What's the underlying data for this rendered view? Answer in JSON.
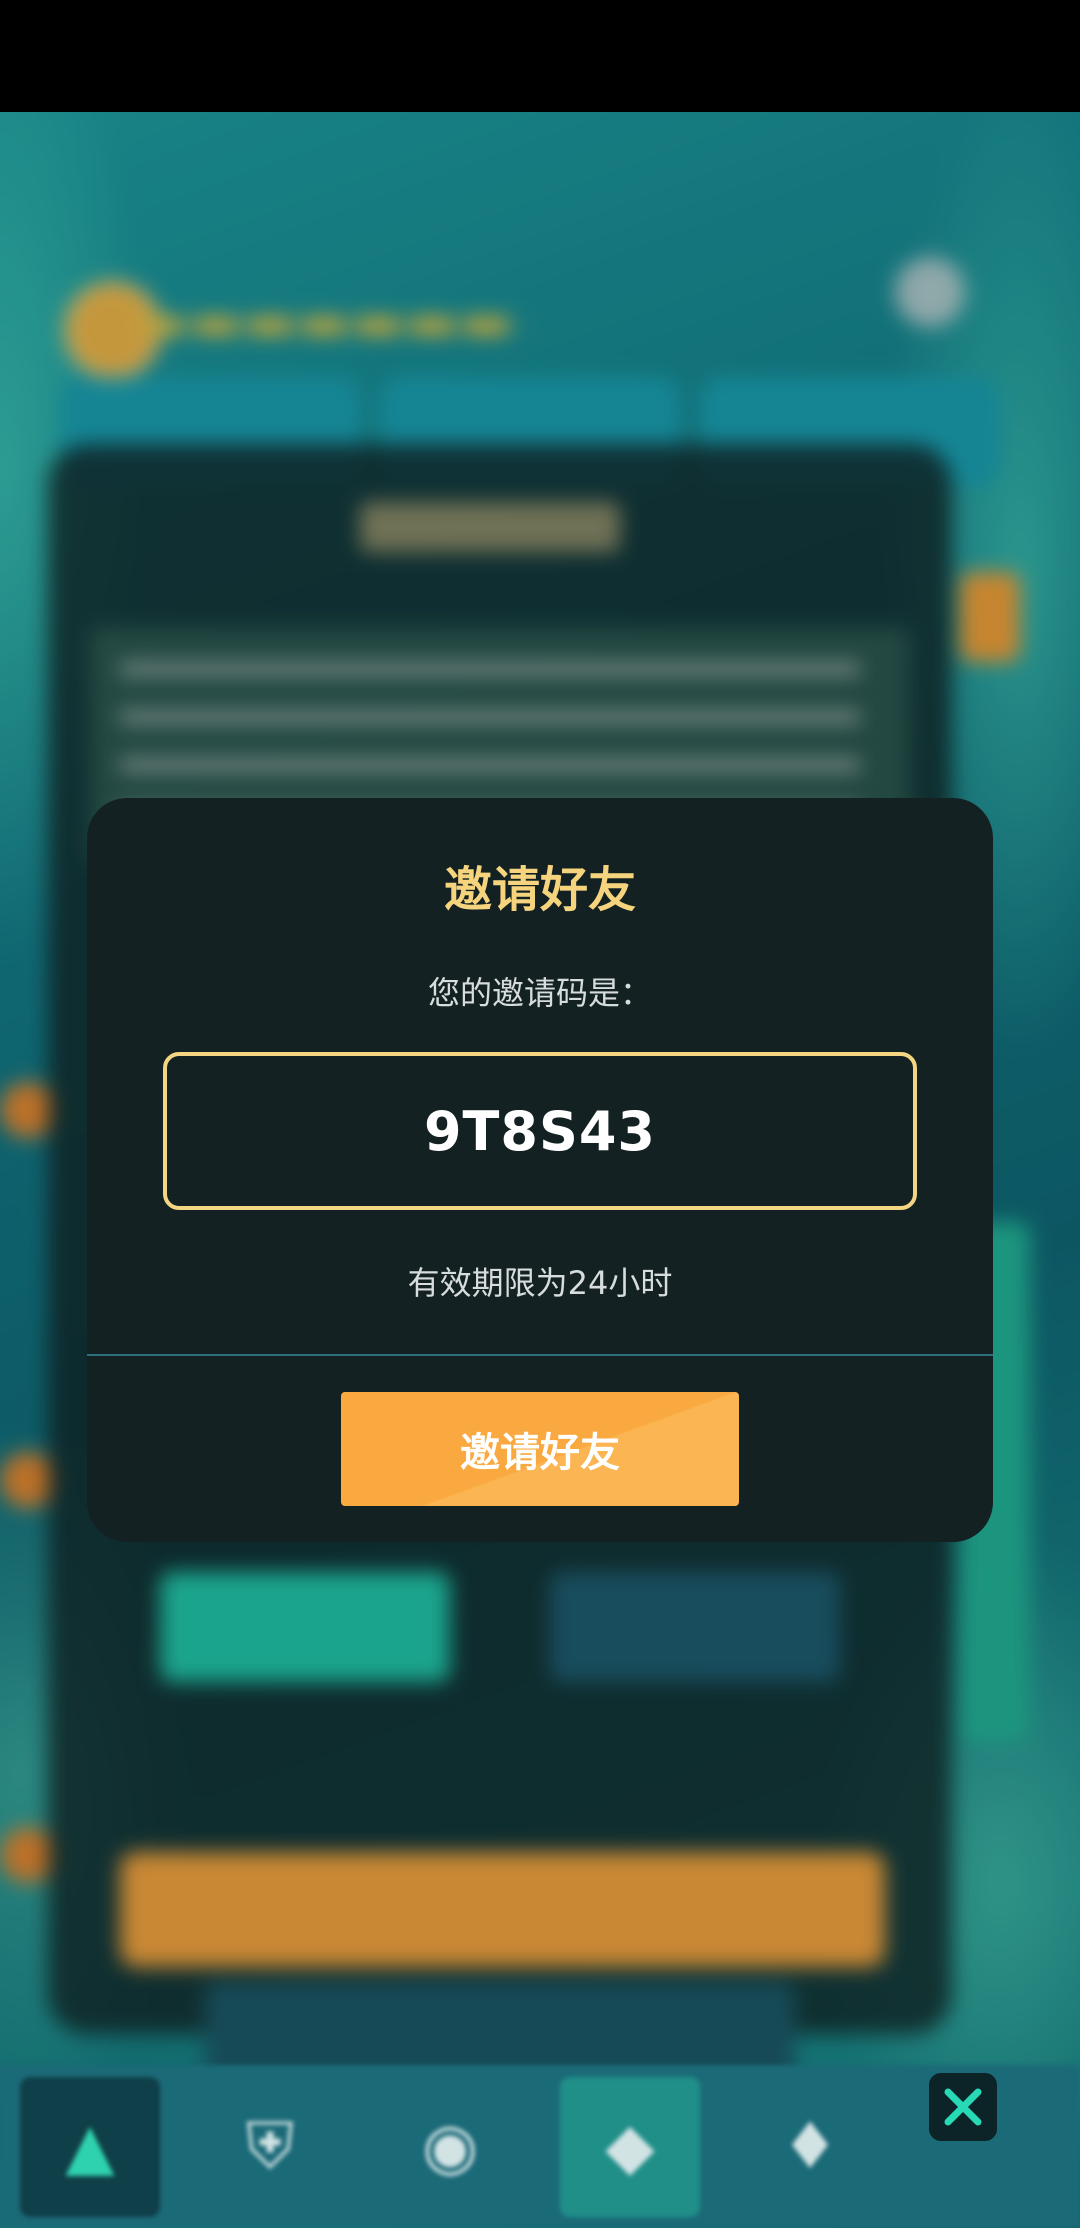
{
  "dialog": {
    "title": "邀请好友",
    "label": "您的邀请码是：",
    "invite_code": "9T8S43",
    "validity": "有效期限为24小时",
    "button_label": "邀请好友"
  },
  "bottom_nav": {
    "items": [
      {
        "icon": "triangle-logo-icon",
        "glyph": "▲"
      },
      {
        "icon": "shield-icon",
        "glyph": "⛨"
      },
      {
        "icon": "compass-icon",
        "glyph": "◉"
      },
      {
        "icon": "diamond-icon",
        "glyph": "◆"
      },
      {
        "icon": "heart-diamond-icon",
        "glyph": "♦"
      }
    ]
  },
  "close_icon": "close-icon",
  "colors": {
    "dialog_bg": "#142123",
    "title_gold": "#f6d47e",
    "code_border": "#f4d682",
    "button_orange": "#f9a93f",
    "close_x": "#27d9b5"
  }
}
